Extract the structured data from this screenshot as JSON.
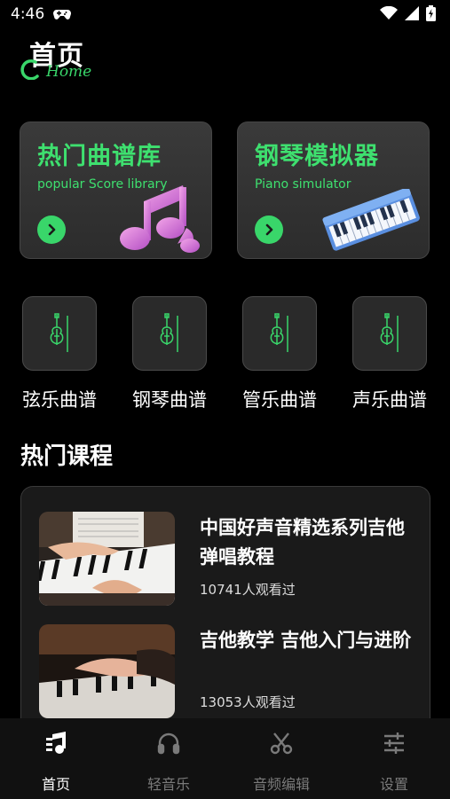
{
  "status": {
    "time": "4:46"
  },
  "header": {
    "title": "首页",
    "subtitle": "Home"
  },
  "cards": [
    {
      "title": "热门曲谱库",
      "subtitle": "popular Score library"
    },
    {
      "title": "钢琴模拟器",
      "subtitle": "Piano simulator"
    }
  ],
  "categories": [
    {
      "label": "弦乐曲谱"
    },
    {
      "label": "钢琴曲谱"
    },
    {
      "label": "管乐曲谱"
    },
    {
      "label": "声乐曲谱"
    }
  ],
  "section": {
    "title": "热门课程"
  },
  "courses": [
    {
      "title": "中国好声音精选系列吉他弹唱教程",
      "views": "10741人观看过"
    },
    {
      "title": "吉他教学 吉他入门与进阶",
      "views": "13053人观看过"
    }
  ],
  "nav": [
    {
      "label": "首页",
      "active": true
    },
    {
      "label": "轻音乐",
      "active": false
    },
    {
      "label": "音频编辑",
      "active": false
    },
    {
      "label": "设置",
      "active": false
    }
  ],
  "colors": {
    "accent": "#39d66a",
    "nav_inactive": "#7a7a7a"
  }
}
